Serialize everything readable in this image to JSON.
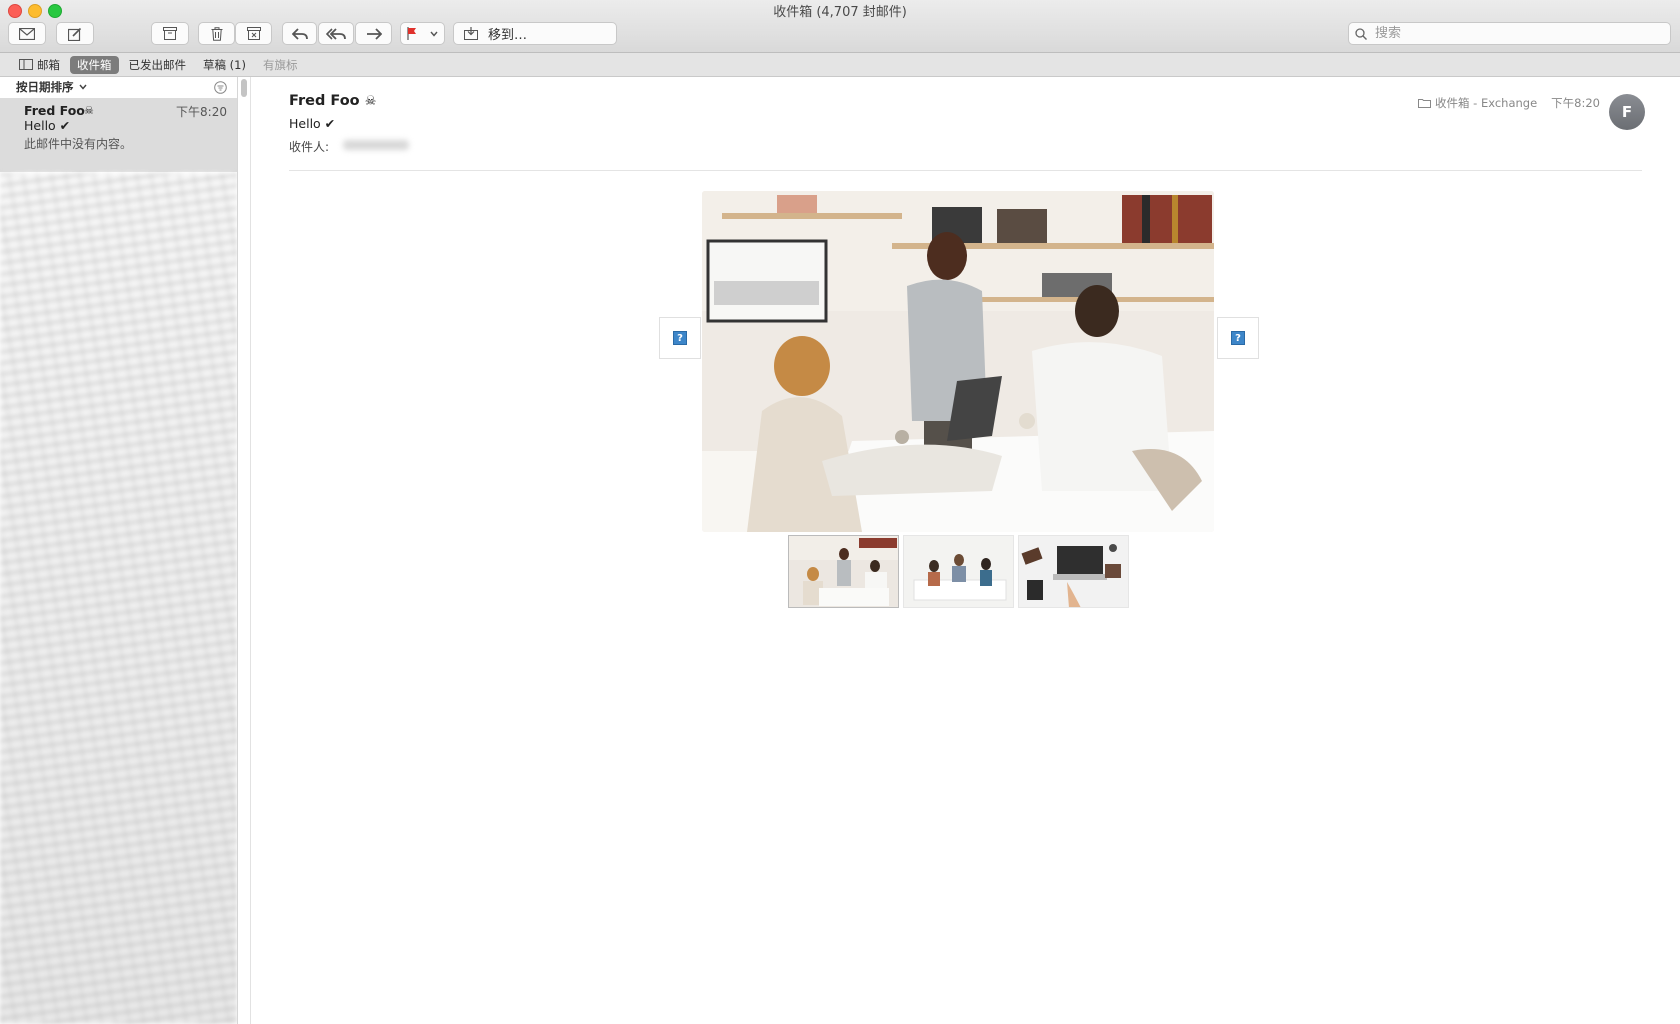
{
  "window": {
    "title": "收件箱 (4,707 封邮件)"
  },
  "toolbar": {
    "buttons": [
      {
        "name": "get-mail",
        "icon": "envelope-icon"
      },
      {
        "name": "compose",
        "icon": "compose-icon"
      },
      {
        "name": "archive",
        "icon": "archive-icon"
      },
      {
        "name": "delete",
        "icon": "trash-icon"
      },
      {
        "name": "junk",
        "icon": "junk-icon"
      },
      {
        "name": "reply",
        "icon": "reply-icon"
      },
      {
        "name": "reply-all",
        "icon": "reply-all-icon"
      },
      {
        "name": "forward",
        "icon": "forward-icon"
      },
      {
        "name": "flag",
        "icon": "flag-icon"
      }
    ],
    "flag_color": "#e0312b",
    "move_label": "移到…",
    "search_placeholder": "搜索"
  },
  "favorites": {
    "mailboxes_label": "邮箱",
    "inbox_label": "收件箱",
    "sent_label": "已发出邮件",
    "drafts_label": "草稿 (1)",
    "flagged_label": "有旗标"
  },
  "message_list": {
    "sort_label": "按日期排序",
    "selected": {
      "sender": "Fred Foo",
      "time": "下午8:20",
      "subject": "Hello ✔",
      "preview": "此邮件中没有内容。"
    }
  },
  "message": {
    "sender": "Fred Foo",
    "subject": "Hello ✔",
    "to_label": "收件人:",
    "mailbox": "收件箱 - Exchange",
    "time": "下午8:20",
    "avatar_initial": "F"
  },
  "colors": {
    "accent": "#7c7c7c",
    "avatar": "#7b7e83"
  }
}
